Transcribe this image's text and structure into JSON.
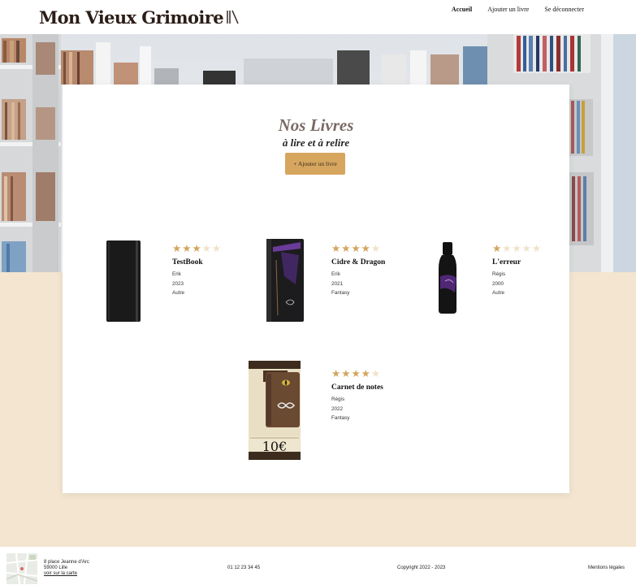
{
  "header": {
    "logo_text": "Mon Vieux Grimoire",
    "nav": [
      {
        "label": "Accueil",
        "active": true
      },
      {
        "label": "Ajouter un livre",
        "active": false
      },
      {
        "label": "Se déconnecter",
        "active": false
      }
    ]
  },
  "main": {
    "title": "Nos Livres",
    "subtitle": "à lire et à relire",
    "add_button": "+ Ajouter un livre",
    "books": [
      {
        "title": "TestBook",
        "author": "Erik",
        "year": "2023",
        "genre": "Autre",
        "rating": 3,
        "cover_icon": "black-notebook"
      },
      {
        "title": "Cidre & Dragon",
        "author": "Erik",
        "year": "2021",
        "genre": "Fantasy",
        "rating": 4,
        "cover_icon": "dark-book-purple"
      },
      {
        "title": "L'erreur",
        "author": "Régis",
        "year": "2000",
        "genre": "Autre",
        "rating": 1,
        "cover_icon": "black-bottle"
      },
      {
        "title": "Carnet de notes",
        "author": "Régis",
        "year": "2022",
        "genre": "Fantasy",
        "rating": 4,
        "cover_icon": "leather-notebook",
        "cover_price": "10€"
      }
    ]
  },
  "footer": {
    "address_line1": "8 place Jeanne d'Arc",
    "address_line2": "59000 Lille",
    "map_link": "voir sur la carte",
    "phone": "01 12 23 34 45",
    "copyright": "Copyright 2022 - 2023",
    "legal": "Mentions légales"
  },
  "colors": {
    "accent": "#d6a65f",
    "star_on": "#d3a45c",
    "star_off": "#f0e2c8",
    "page_bg": "#f3e5cf",
    "title": "#7a6a63"
  }
}
